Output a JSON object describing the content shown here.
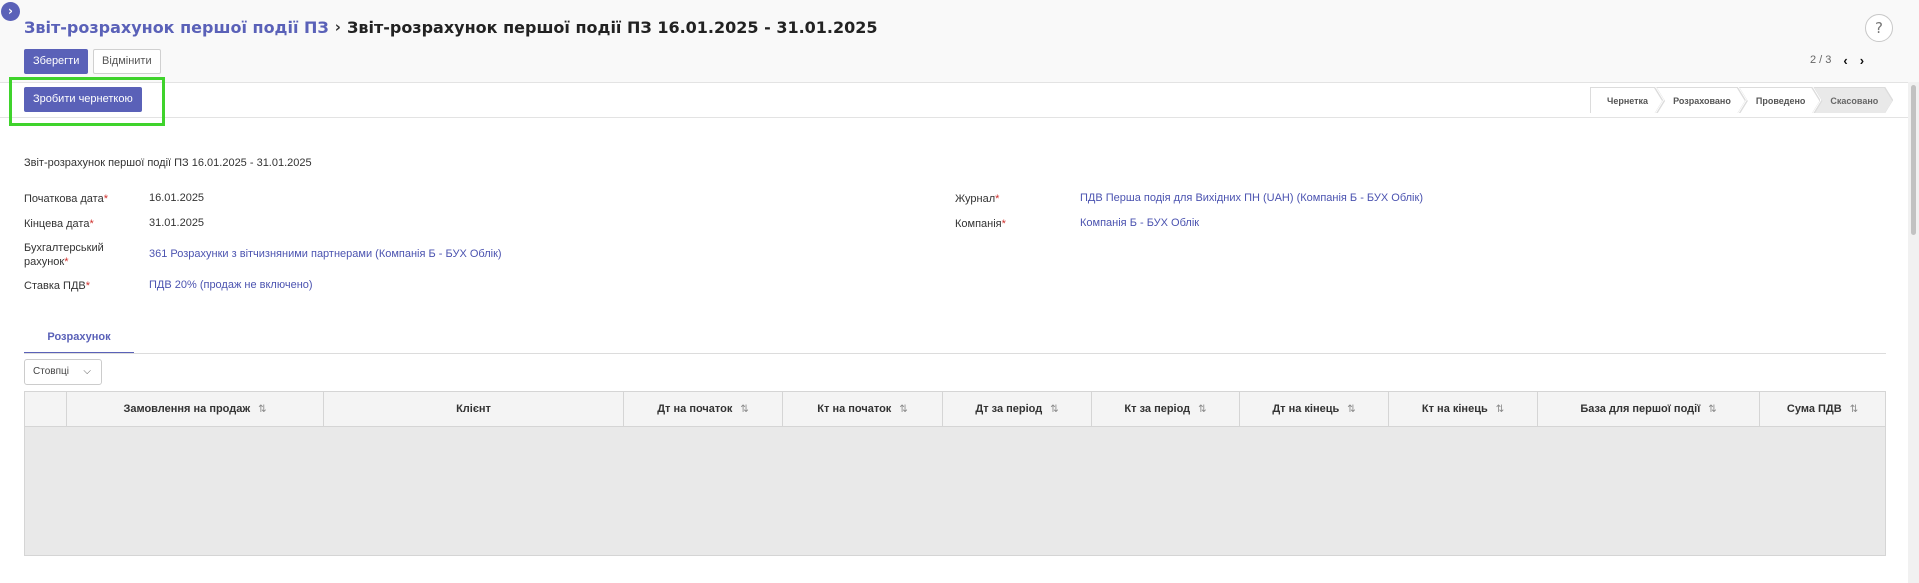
{
  "header": {
    "breadcrumb_parent": "Звіт-розрахунок першої події ПЗ",
    "breadcrumb_separator": "›",
    "breadcrumb_current": "Звіт-розрахунок першої події ПЗ 16.01.2025 - 31.01.2025",
    "help_label": "?"
  },
  "toolbar": {
    "save_label": "Зберегти",
    "discard_label": "Відмінити",
    "make_draft_label": "Зробити чернеткою"
  },
  "pager": {
    "value": "2 / 3",
    "prev_icon": "‹",
    "next_icon": "›"
  },
  "status": {
    "stages": [
      {
        "label": "Чернетка",
        "active": false
      },
      {
        "label": "Розраховано",
        "active": false
      },
      {
        "label": "Проведено",
        "active": false
      },
      {
        "label": "Скасовано",
        "active": true
      }
    ]
  },
  "form": {
    "title": "Звіт-розрахунок першої події ПЗ 16.01.2025 - 31.01.2025",
    "start_date_label": "Початкова дата",
    "start_date_value": "16.01.2025",
    "end_date_label": "Кінцева дата",
    "end_date_value": "31.01.2025",
    "account_label": "Бухгалтерський рахунок",
    "account_label_line1": "Бухгалтерський",
    "account_label_line2": "рахунок",
    "account_value": "361 Розрахунки з вітчизняними партнерами (Компанія Б - БУХ Облік)",
    "vat_label": "Ставка ПДВ",
    "vat_value": "ПДВ 20% (продаж не включено)",
    "journal_label": "Журнал",
    "journal_value": "ПДВ Перша подія для Вихідних ПН (UAH) (Компанія Б - БУХ Облік)",
    "company_label": "Компанія",
    "company_value": "Компанія Б - БУХ Облік",
    "required_mark": "*"
  },
  "tabs": {
    "active_label": "Розрахунок"
  },
  "table": {
    "columns_button_label": "Стовпці",
    "columns_button_icon": "chevron-down-icon",
    "sort_icon": "⇅",
    "columns": [
      "Замовлення на продаж",
      "Клієнт",
      "Дт на початок",
      "Кт на початок",
      "Дт за період",
      "Кт за період",
      "Дт на кінець",
      "Кт на кінець",
      "База для першої події",
      "Сума ПДВ"
    ],
    "rows": []
  },
  "colors": {
    "accent": "#5a61b8",
    "highlight": "#3fd32c",
    "required": "#d0312d"
  }
}
